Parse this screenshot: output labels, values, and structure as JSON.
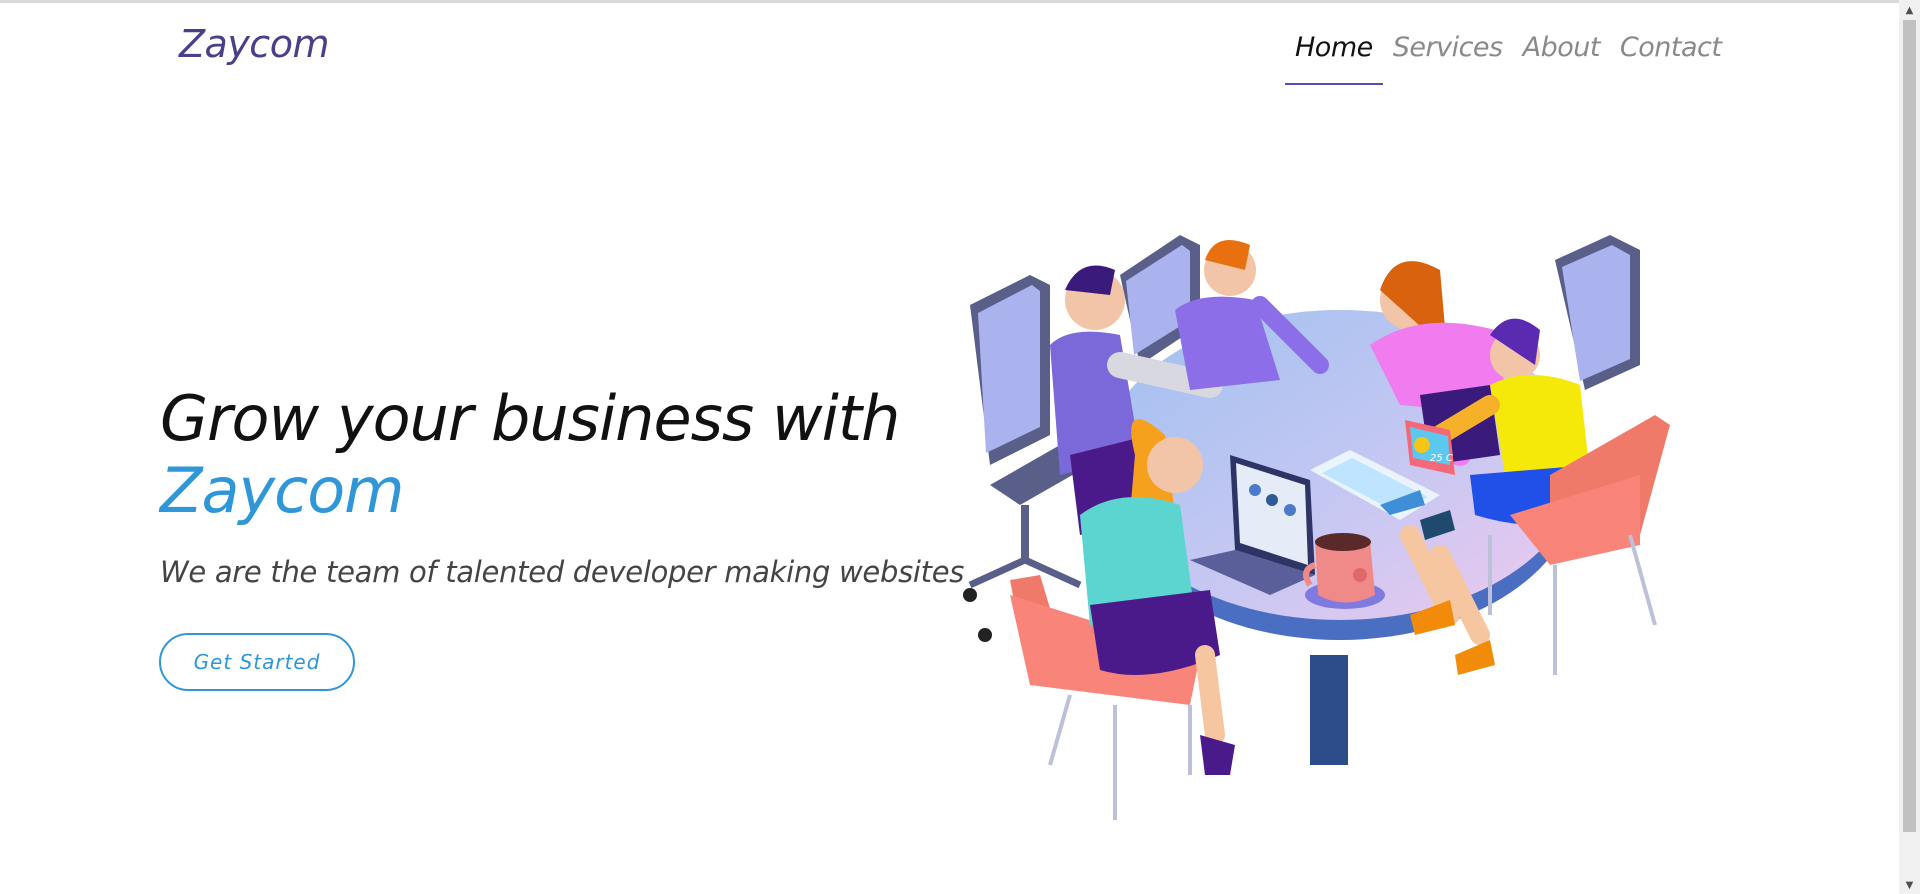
{
  "brand": "Zaycom",
  "nav": {
    "items": [
      {
        "label": "Home",
        "active": true
      },
      {
        "label": "Services",
        "active": false
      },
      {
        "label": "About",
        "active": false
      },
      {
        "label": "Contact",
        "active": false
      }
    ]
  },
  "hero": {
    "title_line1": "Grow your business with",
    "title_accent": "Zaycom",
    "subtitle": "We are the team of talented developer making websites",
    "cta_label": "Get Started"
  },
  "illustration": {
    "icon": "team-meeting-illustration",
    "badge_text": "25 C"
  },
  "colors": {
    "brand": "#4a3f88",
    "accent": "#2f96d8",
    "nav_active_underline": "#5b4bb7"
  }
}
